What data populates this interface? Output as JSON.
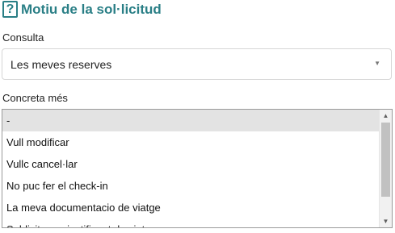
{
  "section": {
    "title": "Motiu de la sol·licitud",
    "help_icon_glyph": "?"
  },
  "consulta": {
    "label": "Consulta",
    "selected_value": "Les meves reserves",
    "arrow_glyph": "▼"
  },
  "concreta": {
    "label": "Concreta més",
    "options": [
      "-",
      "Vull modificar",
      "Vullc cancel·lar",
      "No puc fer el check-in",
      "La meva documentacio de viatge",
      "Sol·licitar un justificant de viatge"
    ],
    "selected_index": 0,
    "scroll_up_glyph": "▲",
    "scroll_down_glyph": "▼"
  },
  "colors": {
    "accent": "#2a7f86",
    "selected_bg": "#e3e3e3"
  }
}
